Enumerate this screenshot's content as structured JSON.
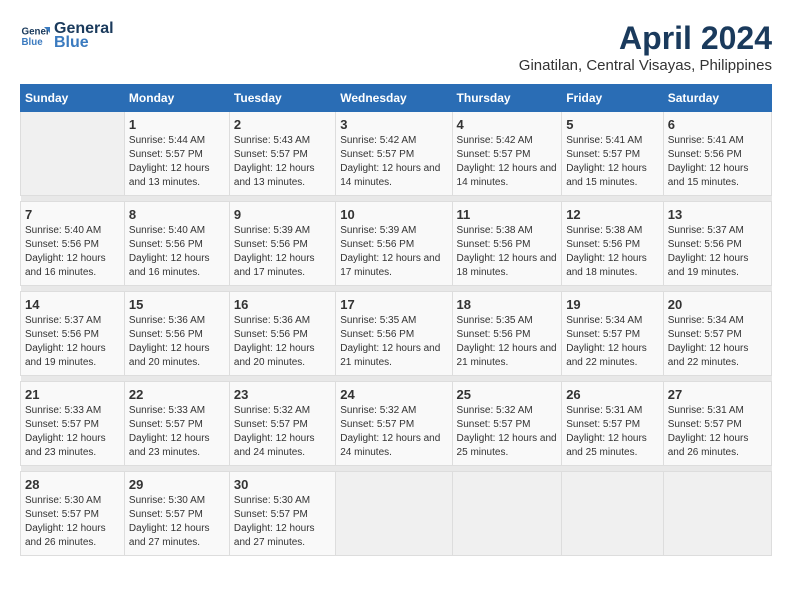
{
  "header": {
    "logo_line1": "General",
    "logo_line2": "Blue",
    "month_year": "April 2024",
    "location": "Ginatilan, Central Visayas, Philippines"
  },
  "days_of_week": [
    "Sunday",
    "Monday",
    "Tuesday",
    "Wednesday",
    "Thursday",
    "Friday",
    "Saturday"
  ],
  "weeks": [
    {
      "cells": [
        {
          "day": "",
          "empty": true
        },
        {
          "day": "1",
          "sunrise": "5:44 AM",
          "sunset": "5:57 PM",
          "daylight": "12 hours and 13 minutes."
        },
        {
          "day": "2",
          "sunrise": "5:43 AM",
          "sunset": "5:57 PM",
          "daylight": "12 hours and 13 minutes."
        },
        {
          "day": "3",
          "sunrise": "5:42 AM",
          "sunset": "5:57 PM",
          "daylight": "12 hours and 14 minutes."
        },
        {
          "day": "4",
          "sunrise": "5:42 AM",
          "sunset": "5:57 PM",
          "daylight": "12 hours and 14 minutes."
        },
        {
          "day": "5",
          "sunrise": "5:41 AM",
          "sunset": "5:57 PM",
          "daylight": "12 hours and 15 minutes."
        },
        {
          "day": "6",
          "sunrise": "5:41 AM",
          "sunset": "5:56 PM",
          "daylight": "12 hours and 15 minutes."
        }
      ]
    },
    {
      "cells": [
        {
          "day": "7",
          "sunrise": "5:40 AM",
          "sunset": "5:56 PM",
          "daylight": "12 hours and 16 minutes."
        },
        {
          "day": "8",
          "sunrise": "5:40 AM",
          "sunset": "5:56 PM",
          "daylight": "12 hours and 16 minutes."
        },
        {
          "day": "9",
          "sunrise": "5:39 AM",
          "sunset": "5:56 PM",
          "daylight": "12 hours and 17 minutes."
        },
        {
          "day": "10",
          "sunrise": "5:39 AM",
          "sunset": "5:56 PM",
          "daylight": "12 hours and 17 minutes."
        },
        {
          "day": "11",
          "sunrise": "5:38 AM",
          "sunset": "5:56 PM",
          "daylight": "12 hours and 18 minutes."
        },
        {
          "day": "12",
          "sunrise": "5:38 AM",
          "sunset": "5:56 PM",
          "daylight": "12 hours and 18 minutes."
        },
        {
          "day": "13",
          "sunrise": "5:37 AM",
          "sunset": "5:56 PM",
          "daylight": "12 hours and 19 minutes."
        }
      ]
    },
    {
      "cells": [
        {
          "day": "14",
          "sunrise": "5:37 AM",
          "sunset": "5:56 PM",
          "daylight": "12 hours and 19 minutes."
        },
        {
          "day": "15",
          "sunrise": "5:36 AM",
          "sunset": "5:56 PM",
          "daylight": "12 hours and 20 minutes."
        },
        {
          "day": "16",
          "sunrise": "5:36 AM",
          "sunset": "5:56 PM",
          "daylight": "12 hours and 20 minutes."
        },
        {
          "day": "17",
          "sunrise": "5:35 AM",
          "sunset": "5:56 PM",
          "daylight": "12 hours and 21 minutes."
        },
        {
          "day": "18",
          "sunrise": "5:35 AM",
          "sunset": "5:56 PM",
          "daylight": "12 hours and 21 minutes."
        },
        {
          "day": "19",
          "sunrise": "5:34 AM",
          "sunset": "5:57 PM",
          "daylight": "12 hours and 22 minutes."
        },
        {
          "day": "20",
          "sunrise": "5:34 AM",
          "sunset": "5:57 PM",
          "daylight": "12 hours and 22 minutes."
        }
      ]
    },
    {
      "cells": [
        {
          "day": "21",
          "sunrise": "5:33 AM",
          "sunset": "5:57 PM",
          "daylight": "12 hours and 23 minutes."
        },
        {
          "day": "22",
          "sunrise": "5:33 AM",
          "sunset": "5:57 PM",
          "daylight": "12 hours and 23 minutes."
        },
        {
          "day": "23",
          "sunrise": "5:32 AM",
          "sunset": "5:57 PM",
          "daylight": "12 hours and 24 minutes."
        },
        {
          "day": "24",
          "sunrise": "5:32 AM",
          "sunset": "5:57 PM",
          "daylight": "12 hours and 24 minutes."
        },
        {
          "day": "25",
          "sunrise": "5:32 AM",
          "sunset": "5:57 PM",
          "daylight": "12 hours and 25 minutes."
        },
        {
          "day": "26",
          "sunrise": "5:31 AM",
          "sunset": "5:57 PM",
          "daylight": "12 hours and 25 minutes."
        },
        {
          "day": "27",
          "sunrise": "5:31 AM",
          "sunset": "5:57 PM",
          "daylight": "12 hours and 26 minutes."
        }
      ]
    },
    {
      "cells": [
        {
          "day": "28",
          "sunrise": "5:30 AM",
          "sunset": "5:57 PM",
          "daylight": "12 hours and 26 minutes."
        },
        {
          "day": "29",
          "sunrise": "5:30 AM",
          "sunset": "5:57 PM",
          "daylight": "12 hours and 27 minutes."
        },
        {
          "day": "30",
          "sunrise": "5:30 AM",
          "sunset": "5:57 PM",
          "daylight": "12 hours and 27 minutes."
        },
        {
          "day": "",
          "empty": true
        },
        {
          "day": "",
          "empty": true
        },
        {
          "day": "",
          "empty": true
        },
        {
          "day": "",
          "empty": true
        }
      ]
    }
  ]
}
